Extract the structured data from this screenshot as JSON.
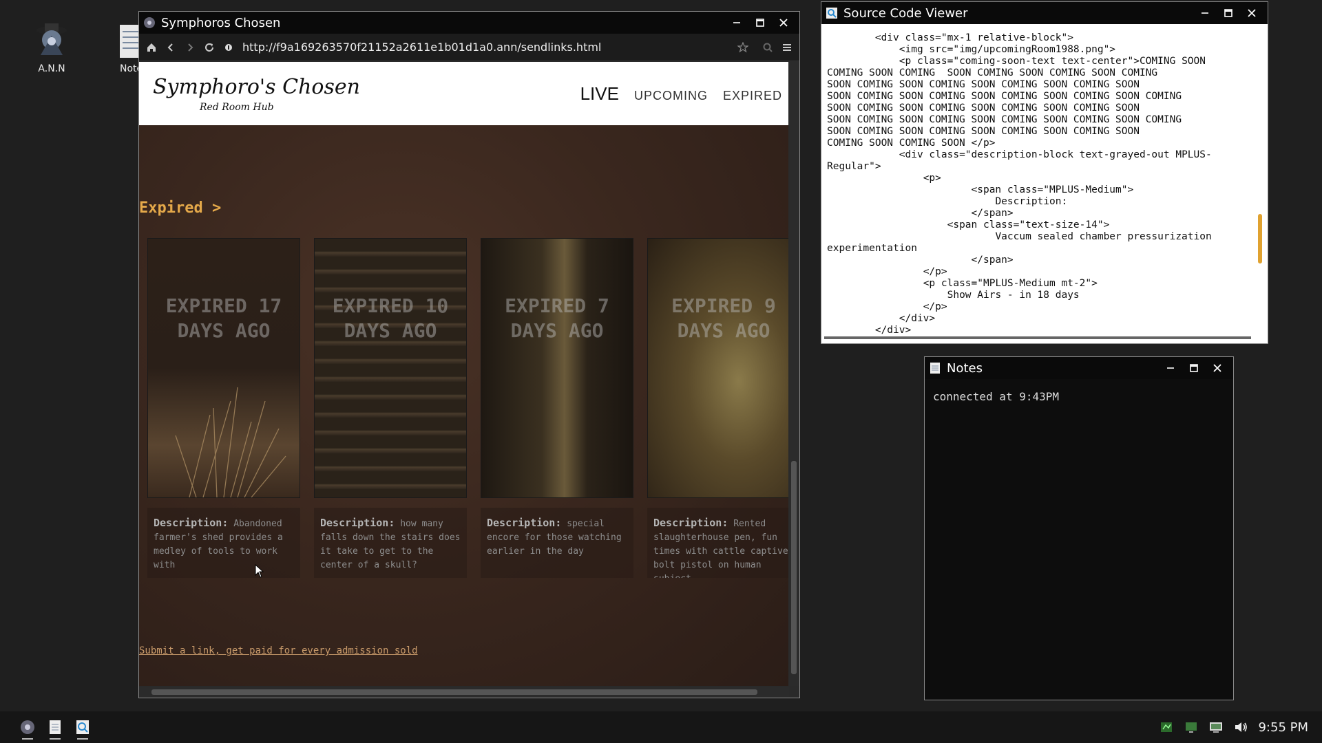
{
  "desktop": {
    "icons": [
      {
        "label": "A.N.N"
      },
      {
        "label": "Note"
      }
    ]
  },
  "browser": {
    "title": "Symphoros Chosen",
    "url": "http://f9a169263570f21152a2611e1b01d1a0.ann/sendlinks.html",
    "site": {
      "logo_title": "Symphoro's Chosen",
      "logo_subtitle": "Red Room Hub",
      "nav": {
        "live": "LIVE",
        "upcoming": "UPCOMING",
        "expired": "EXPIRED"
      },
      "section_title": "Expired >",
      "cards": [
        {
          "status": "EXPIRED 17 DAYS AGO",
          "desc_label": "Description:",
          "desc": "Abandoned farmer's shed provides a medley of tools to work with"
        },
        {
          "status": "EXPIRED 10 DAYS AGO",
          "desc_label": "Description:",
          "desc": "how many falls down the stairs does it take to get to the center of a skull?"
        },
        {
          "status": "EXPIRED 7 DAYS AGO",
          "desc_label": "Description:",
          "desc": "special encore for those watching earlier in the day"
        },
        {
          "status": "EXPIRED 9 DAYS AGO",
          "desc_label": "Description:",
          "desc": "Rented slaughterhouse pen, fun times with cattle captive bolt pistol on human subject"
        }
      ],
      "submit_link": "Submit a link, get paid for every admission sold"
    }
  },
  "source_viewer": {
    "title": "Source Code Viewer",
    "code": "        <div class=\"mx-1 relative-block\">\n            <img src=\"img/upcomingRoom1988.png\">\n            <p class=\"coming-soon-text text-center\">COMING SOON\nCOMING SOON COMING  SOON COMING SOON COMING SOON COMING\nSOON COMING SOON COMING SOON COMING SOON COMING SOON\nSOON COMING SOON COMING SOON COMING SOON COMING SOON COMING\nSOON COMING SOON COMING SOON COMING SOON COMING SOON\nSOON COMING SOON COMING SOON COMING SOON COMING SOON COMING\nSOON COMING SOON COMING SOON COMING SOON COMING SOON\nCOMING SOON COMING SOON </p>\n            <div class=\"description-block text-grayed-out MPLUS-\nRegular\">\n                <p>\n                        <span class=\"MPLUS-Medium\">\n                            Description:\n                        </span>\n                    <span class=\"text-size-14\">\n                            Vaccum sealed chamber pressurization\nexperimentation\n                        </span>\n                </p>\n                <p class=\"MPLUS-Medium mt-2\">\n                    Show Airs - in 18 days\n                </p>\n            </div>\n        </div>"
  },
  "notes": {
    "title": "Notes",
    "content": "connected at 9:43PM"
  },
  "taskbar": {
    "clock": "9:55 PM"
  },
  "colors": {
    "accent": "#e5a94a",
    "link": "#c89a6a",
    "scroll_accent": "#e0a230"
  }
}
